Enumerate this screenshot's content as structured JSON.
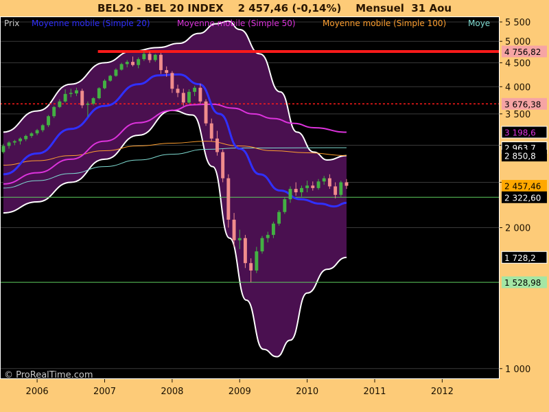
{
  "header": {
    "instrument": "BEL20 - BEL 20 INDEX",
    "quote": "2 457,46 (-0,14%)",
    "period": "Mensuel  31 Aou"
  },
  "watermark": "© ProRealTime.com",
  "legend": [
    {
      "text": "Prix",
      "color": "#c8c8c8"
    },
    {
      "text": "Moyenne mobile (Simple 20)",
      "color": "#3030ff"
    },
    {
      "text": "Moyenne mobile (Simple 50)",
      "color": "#dd33dd"
    },
    {
      "text": "Moyenne mobile (Simple 100)",
      "color": "#ffa030"
    },
    {
      "text": "Moye",
      "color": "#7fdcd2"
    }
  ],
  "colors": {
    "background": "#000000",
    "axis_panel": "#fdcb78",
    "candle_up": "#43b043",
    "candle_down": "#f08c8c",
    "band_fill": "#4a1050",
    "band_edge": "#ffffff",
    "sma20": "#3030ff",
    "sma50": "#dd33dd",
    "sma100": "#ffa030",
    "sma200": "#7fdcd2",
    "resistance": "#ff1a1a",
    "support": "#5fd05f"
  },
  "chart_data": {
    "type": "candlestick",
    "title": "BEL20 - BEL 20 INDEX",
    "period": "monthly",
    "y_axis": {
      "scale": "log",
      "range": [
        950,
        5650
      ],
      "ticks": [
        {
          "value": 5500,
          "label": "5 500"
        },
        {
          "value": 5000,
          "label": "5 000"
        },
        {
          "value": 4500,
          "label": "4 500"
        },
        {
          "value": 4000,
          "label": "4 000"
        },
        {
          "value": 3500,
          "label": "3 500"
        },
        {
          "value": 3000,
          "label": ""
        },
        {
          "value": 2500,
          "label": ""
        },
        {
          "value": 2000,
          "label": "2 000"
        },
        {
          "value": 1000,
          "label": "1 000"
        }
      ]
    },
    "x_axis": {
      "range": [
        2005.45,
        2012.85
      ],
      "ticks": [
        {
          "value": 2006,
          "label": "2006"
        },
        {
          "value": 2007,
          "label": "2007"
        },
        {
          "value": 2008,
          "label": "2008"
        },
        {
          "value": 2009,
          "label": "2009"
        },
        {
          "value": 2010,
          "label": "2010"
        },
        {
          "value": 2011,
          "label": "2011"
        },
        {
          "value": 2012,
          "label": "2012"
        }
      ]
    },
    "price_labels": [
      {
        "value": 4756.82,
        "label": "4 756,82",
        "bg": "#f6a4a4",
        "fg": "#000000"
      },
      {
        "value": 3676.38,
        "label": "3 676,38",
        "bg": "#f6a4a4",
        "fg": "#000000"
      },
      {
        "value": 3198.6,
        "label": "3 198,6",
        "bg": "#000000",
        "fg": "#dd33dd",
        "border": "#ffffff"
      },
      {
        "value": 2963.7,
        "label": "2 963,7",
        "bg": "#000000",
        "fg": "#ffffff",
        "border": "#ffffff"
      },
      {
        "value": 2850.8,
        "label": "2 850,8",
        "bg": "#000000",
        "fg": "#ffffff"
      },
      {
        "value": 2457.46,
        "label": "2 457,46",
        "bg": "#ffa800",
        "fg": "#000000"
      },
      {
        "value": 2322.6,
        "label": "2 322,60",
        "bg": "#000000",
        "fg": "#ffffff"
      },
      {
        "value": 1728.2,
        "label": "1 728,2",
        "bg": "#000000",
        "fg": "#ffffff",
        "border": "#ffffff"
      },
      {
        "value": 1528.98,
        "label": "1 528,98",
        "bg": "#a4e6a4",
        "fg": "#000000"
      }
    ],
    "horizontal_lines": [
      {
        "value": 4756.82,
        "style": "solid",
        "color": "#ff1a1a",
        "x_start": 2006.9
      },
      {
        "value": 3676.38,
        "style": "dotted",
        "color": "#ff1a1a"
      },
      {
        "value": 2322.6,
        "style": "solid",
        "color": "#5fd05f"
      },
      {
        "value": 1528.98,
        "style": "solid",
        "color": "#5fd05f"
      }
    ],
    "candles": [
      {
        "t": 2005.5,
        "o": 2900,
        "h": 3020,
        "l": 2880,
        "c": 2990
      },
      {
        "t": 2005.583,
        "o": 2990,
        "h": 3060,
        "l": 2950,
        "c": 3040
      },
      {
        "t": 2005.667,
        "o": 3040,
        "h": 3080,
        "l": 3000,
        "c": 3060
      },
      {
        "t": 2005.75,
        "o": 3060,
        "h": 3120,
        "l": 3010,
        "c": 3100
      },
      {
        "t": 2005.833,
        "o": 3090,
        "h": 3160,
        "l": 3060,
        "c": 3140
      },
      {
        "t": 2005.917,
        "o": 3140,
        "h": 3200,
        "l": 3110,
        "c": 3180
      },
      {
        "t": 2006.0,
        "o": 3180,
        "h": 3250,
        "l": 3150,
        "c": 3230
      },
      {
        "t": 2006.083,
        "o": 3230,
        "h": 3330,
        "l": 3200,
        "c": 3310
      },
      {
        "t": 2006.167,
        "o": 3310,
        "h": 3480,
        "l": 3280,
        "c": 3460
      },
      {
        "t": 2006.25,
        "o": 3460,
        "h": 3640,
        "l": 3430,
        "c": 3620
      },
      {
        "t": 2006.333,
        "o": 3620,
        "h": 3760,
        "l": 3600,
        "c": 3720
      },
      {
        "t": 2006.417,
        "o": 3720,
        "h": 3950,
        "l": 3700,
        "c": 3860
      },
      {
        "t": 2006.5,
        "o": 3860,
        "h": 3960,
        "l": 3800,
        "c": 3880
      },
      {
        "t": 2006.583,
        "o": 3870,
        "h": 3980,
        "l": 3820,
        "c": 3930
      },
      {
        "t": 2006.667,
        "o": 3920,
        "h": 3960,
        "l": 3600,
        "c": 3650
      },
      {
        "t": 2006.75,
        "o": 3660,
        "h": 3720,
        "l": 3450,
        "c": 3680
      },
      {
        "t": 2006.833,
        "o": 3680,
        "h": 3800,
        "l": 3650,
        "c": 3780
      },
      {
        "t": 2006.917,
        "o": 3780,
        "h": 3990,
        "l": 3760,
        "c": 3970
      },
      {
        "t": 2007.0,
        "o": 3970,
        "h": 4150,
        "l": 3950,
        "c": 4120
      },
      {
        "t": 2007.083,
        "o": 4120,
        "h": 4240,
        "l": 4100,
        "c": 4220
      },
      {
        "t": 2007.167,
        "o": 4220,
        "h": 4380,
        "l": 4200,
        "c": 4350
      },
      {
        "t": 2007.25,
        "o": 4350,
        "h": 4500,
        "l": 4330,
        "c": 4470
      },
      {
        "t": 2007.333,
        "o": 4470,
        "h": 4560,
        "l": 4400,
        "c": 4520
      },
      {
        "t": 2007.417,
        "o": 4520,
        "h": 4640,
        "l": 4420,
        "c": 4450
      },
      {
        "t": 2007.5,
        "o": 4450,
        "h": 4620,
        "l": 4380,
        "c": 4580
      },
      {
        "t": 2007.583,
        "o": 4580,
        "h": 4760,
        "l": 4540,
        "c": 4700
      },
      {
        "t": 2007.667,
        "o": 4700,
        "h": 4750,
        "l": 4500,
        "c": 4560
      },
      {
        "t": 2007.75,
        "o": 4560,
        "h": 4700,
        "l": 4520,
        "c": 4680
      },
      {
        "t": 2007.833,
        "o": 4680,
        "h": 4720,
        "l": 4260,
        "c": 4340
      },
      {
        "t": 2007.917,
        "o": 4340,
        "h": 4420,
        "l": 4200,
        "c": 4280
      },
      {
        "t": 2008.0,
        "o": 4280,
        "h": 4320,
        "l": 3880,
        "c": 3960
      },
      {
        "t": 2008.083,
        "o": 3960,
        "h": 4040,
        "l": 3800,
        "c": 3880
      },
      {
        "t": 2008.167,
        "o": 3880,
        "h": 3960,
        "l": 3640,
        "c": 3700
      },
      {
        "t": 2008.25,
        "o": 3700,
        "h": 3950,
        "l": 3680,
        "c": 3900
      },
      {
        "t": 2008.333,
        "o": 3900,
        "h": 4020,
        "l": 3820,
        "c": 3980
      },
      {
        "t": 2008.417,
        "o": 3980,
        "h": 4060,
        "l": 3680,
        "c": 3720
      },
      {
        "t": 2008.5,
        "o": 3720,
        "h": 3760,
        "l": 3300,
        "c": 3340
      },
      {
        "t": 2008.583,
        "o": 3340,
        "h": 3420,
        "l": 3060,
        "c": 3100
      },
      {
        "t": 2008.667,
        "o": 3100,
        "h": 3220,
        "l": 2850,
        "c": 2900
      },
      {
        "t": 2008.75,
        "o": 2900,
        "h": 2940,
        "l": 2500,
        "c": 2550
      },
      {
        "t": 2008.833,
        "o": 2550,
        "h": 2600,
        "l": 2000,
        "c": 2080
      },
      {
        "t": 2008.917,
        "o": 2080,
        "h": 2150,
        "l": 1820,
        "c": 1880
      },
      {
        "t": 2009.0,
        "o": 1880,
        "h": 1980,
        "l": 1800,
        "c": 1900
      },
      {
        "t": 2009.083,
        "o": 1900,
        "h": 1930,
        "l": 1640,
        "c": 1680
      },
      {
        "t": 2009.167,
        "o": 1680,
        "h": 1720,
        "l": 1529,
        "c": 1620
      },
      {
        "t": 2009.25,
        "o": 1620,
        "h": 1820,
        "l": 1600,
        "c": 1780
      },
      {
        "t": 2009.333,
        "o": 1780,
        "h": 1920,
        "l": 1760,
        "c": 1900
      },
      {
        "t": 2009.417,
        "o": 1900,
        "h": 1960,
        "l": 1860,
        "c": 1930
      },
      {
        "t": 2009.5,
        "o": 1930,
        "h": 2060,
        "l": 1900,
        "c": 2040
      },
      {
        "t": 2009.583,
        "o": 2040,
        "h": 2180,
        "l": 2020,
        "c": 2160
      },
      {
        "t": 2009.667,
        "o": 2160,
        "h": 2320,
        "l": 2140,
        "c": 2300
      },
      {
        "t": 2009.75,
        "o": 2300,
        "h": 2450,
        "l": 2260,
        "c": 2420
      },
      {
        "t": 2009.833,
        "o": 2420,
        "h": 2500,
        "l": 2340,
        "c": 2380
      },
      {
        "t": 2009.917,
        "o": 2380,
        "h": 2460,
        "l": 2330,
        "c": 2430
      },
      {
        "t": 2010.0,
        "o": 2430,
        "h": 2520,
        "l": 2380,
        "c": 2460
      },
      {
        "t": 2010.083,
        "o": 2460,
        "h": 2510,
        "l": 2400,
        "c": 2430
      },
      {
        "t": 2010.167,
        "o": 2430,
        "h": 2540,
        "l": 2410,
        "c": 2510
      },
      {
        "t": 2010.25,
        "o": 2510,
        "h": 2580,
        "l": 2470,
        "c": 2550
      },
      {
        "t": 2010.333,
        "o": 2550,
        "h": 2600,
        "l": 2420,
        "c": 2450
      },
      {
        "t": 2010.417,
        "o": 2450,
        "h": 2500,
        "l": 2310,
        "c": 2350
      },
      {
        "t": 2010.5,
        "o": 2350,
        "h": 2520,
        "l": 2330,
        "c": 2500
      },
      {
        "t": 2010.583,
        "o": 2500,
        "h": 2540,
        "l": 2420,
        "c": 2457.46
      }
    ],
    "bollinger_upper": [
      {
        "t": 2005.5,
        "v": 3200
      },
      {
        "t": 2006.0,
        "v": 3550
      },
      {
        "t": 2006.5,
        "v": 4050
      },
      {
        "t": 2007.0,
        "v": 4500
      },
      {
        "t": 2007.4,
        "v": 4760
      },
      {
        "t": 2007.8,
        "v": 4850
      },
      {
        "t": 2008.1,
        "v": 4950
      },
      {
        "t": 2008.4,
        "v": 5200
      },
      {
        "t": 2008.65,
        "v": 5450
      },
      {
        "t": 2008.83,
        "v": 5520
      },
      {
        "t": 2009.0,
        "v": 5300
      },
      {
        "t": 2009.3,
        "v": 4700
      },
      {
        "t": 2009.6,
        "v": 3900
      },
      {
        "t": 2009.85,
        "v": 3200
      },
      {
        "t": 2010.1,
        "v": 2900
      },
      {
        "t": 2010.3,
        "v": 2790
      },
      {
        "t": 2010.583,
        "v": 2850
      }
    ],
    "bollinger_lower": [
      {
        "t": 2005.5,
        "v": 2150
      },
      {
        "t": 2006.0,
        "v": 2270
      },
      {
        "t": 2006.5,
        "v": 2500
      },
      {
        "t": 2007.0,
        "v": 2800
      },
      {
        "t": 2007.5,
        "v": 3150
      },
      {
        "t": 2008.0,
        "v": 3560
      },
      {
        "t": 2008.3,
        "v": 3480
      },
      {
        "t": 2008.6,
        "v": 2700
      },
      {
        "t": 2008.85,
        "v": 1900
      },
      {
        "t": 2009.1,
        "v": 1400
      },
      {
        "t": 2009.35,
        "v": 1100
      },
      {
        "t": 2009.55,
        "v": 1060
      },
      {
        "t": 2009.75,
        "v": 1150
      },
      {
        "t": 2010.0,
        "v": 1450
      },
      {
        "t": 2010.3,
        "v": 1630
      },
      {
        "t": 2010.583,
        "v": 1728
      }
    ],
    "sma20": [
      {
        "t": 2005.5,
        "v": 2600
      },
      {
        "t": 2006.0,
        "v": 2880
      },
      {
        "t": 2006.5,
        "v": 3250
      },
      {
        "t": 2007.0,
        "v": 3640
      },
      {
        "t": 2007.5,
        "v": 4050
      },
      {
        "t": 2007.8,
        "v": 4230
      },
      {
        "t": 2008.1,
        "v": 4250
      },
      {
        "t": 2008.4,
        "v": 4050
      },
      {
        "t": 2008.7,
        "v": 3500
      },
      {
        "t": 2009.0,
        "v": 2950
      },
      {
        "t": 2009.3,
        "v": 2600
      },
      {
        "t": 2009.6,
        "v": 2400
      },
      {
        "t": 2009.9,
        "v": 2300
      },
      {
        "t": 2010.2,
        "v": 2250
      },
      {
        "t": 2010.4,
        "v": 2220
      },
      {
        "t": 2010.583,
        "v": 2260
      }
    ],
    "sma50": [
      {
        "t": 2005.5,
        "v": 2480
      },
      {
        "t": 2006.0,
        "v": 2620
      },
      {
        "t": 2006.5,
        "v": 2800
      },
      {
        "t": 2007.0,
        "v": 3060
      },
      {
        "t": 2007.5,
        "v": 3350
      },
      {
        "t": 2008.0,
        "v": 3560
      },
      {
        "t": 2008.3,
        "v": 3660
      },
      {
        "t": 2008.6,
        "v": 3670
      },
      {
        "t": 2008.9,
        "v": 3600
      },
      {
        "t": 2009.2,
        "v": 3500
      },
      {
        "t": 2009.5,
        "v": 3420
      },
      {
        "t": 2009.8,
        "v": 3340
      },
      {
        "t": 2010.1,
        "v": 3270
      },
      {
        "t": 2010.583,
        "v": 3198.6
      }
    ],
    "sma100": [
      {
        "t": 2005.5,
        "v": 2720
      },
      {
        "t": 2006.0,
        "v": 2780
      },
      {
        "t": 2006.5,
        "v": 2850
      },
      {
        "t": 2007.0,
        "v": 2920
      },
      {
        "t": 2007.5,
        "v": 2990
      },
      {
        "t": 2008.0,
        "v": 3030
      },
      {
        "t": 2008.5,
        "v": 3060
      },
      {
        "t": 2009.0,
        "v": 2990
      },
      {
        "t": 2009.5,
        "v": 2920
      },
      {
        "t": 2010.0,
        "v": 2890
      },
      {
        "t": 2010.583,
        "v": 2850.8
      }
    ],
    "sma200": [
      {
        "t": 2005.5,
        "v": 2430
      },
      {
        "t": 2006.0,
        "v": 2520
      },
      {
        "t": 2006.5,
        "v": 2610
      },
      {
        "t": 2007.0,
        "v": 2700
      },
      {
        "t": 2007.5,
        "v": 2790
      },
      {
        "t": 2008.0,
        "v": 2870
      },
      {
        "t": 2008.5,
        "v": 2940
      },
      {
        "t": 2009.0,
        "v": 2960
      },
      {
        "t": 2009.5,
        "v": 2960
      },
      {
        "t": 2010.0,
        "v": 2962
      },
      {
        "t": 2010.583,
        "v": 2963.7
      }
    ]
  }
}
